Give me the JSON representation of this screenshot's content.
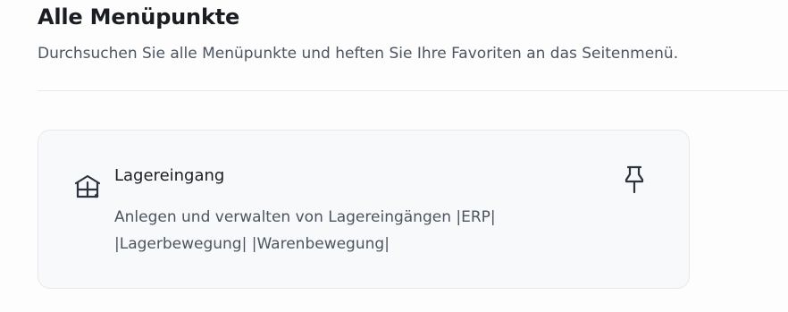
{
  "header": {
    "title": "Alle Menüpunkte",
    "subtitle": "Durchsuchen Sie alle Menüpunkte und heften Sie Ihre Favoriten an das Seitenmenü."
  },
  "menu_items": [
    {
      "title": "Lagereingang",
      "description_line1": "Anlegen und verwalten von Lagereingängen |ERP|",
      "description_line2": "|Lagerbewegung| |Warenbewegung|",
      "icon": "warehouse-icon",
      "pin_icon": "pin-icon"
    }
  ],
  "colors": {
    "title": "#1a1d21",
    "text_secondary": "#4b5561",
    "card_background": "#f8f9fb",
    "card_border": "#e6e8ec",
    "divider": "#e7e9ed",
    "icon": "#2b3440"
  }
}
